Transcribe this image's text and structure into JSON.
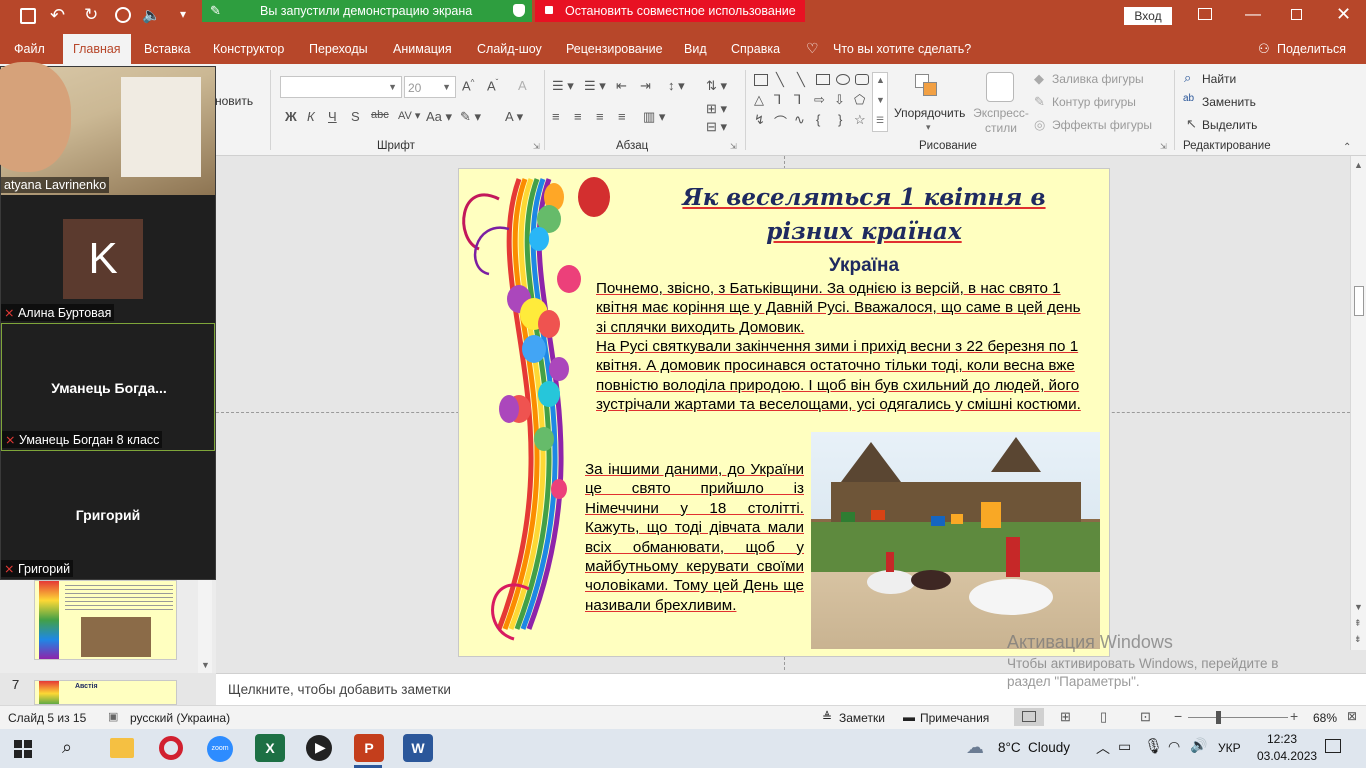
{
  "titlebar": {
    "share_banner": "Вы запустили демонстрацию экрана",
    "stop_share": "Остановить совместное использование",
    "signin": "Вход"
  },
  "ribbon_tabs": [
    "Файл",
    "Главная",
    "Вставка",
    "Конструктор",
    "Переходы",
    "Анимация",
    "Слайд-шоу",
    "Рецензирование",
    "Вид",
    "Справка"
  ],
  "tell_me": "Что вы хотите сделать?",
  "share_label": "Поделиться",
  "ribbon": {
    "clipboard_partial": "новить",
    "font_size": "20",
    "font_group": "Шрифт",
    "paragraph_group": "Абзац",
    "drawing_group": "Рисование",
    "editing_group": "Редактирование",
    "arrange": "Упорядочить",
    "quick_styles": "Экспресс-стили",
    "shape_fill": "Заливка фигуры",
    "shape_outline": "Контур фигуры",
    "shape_effects": "Эффекты фигуры",
    "find": "Найти",
    "replace": "Заменить",
    "select": "Выделить"
  },
  "participants": [
    {
      "name": "atyana Lavrinenko",
      "type": "video"
    },
    {
      "name": "Алина Буртовая",
      "type": "avatar",
      "initial": "K",
      "avatar_color": "#5b3a2e"
    },
    {
      "name": "Уманець Богдан 8 класс",
      "display": "Уманець  Богда...",
      "type": "text"
    },
    {
      "name": "Григорий",
      "display": "Григорий",
      "type": "text"
    }
  ],
  "thumbnail_7": {
    "number": "7",
    "title": "Австія"
  },
  "slide": {
    "title_line1": "Як веселяться 1 квітня в",
    "title_line2": "різних країнах",
    "subtitle": "Україна",
    "para1": "Почнемо, звісно, з Батьківщини. За однією із версій, в нас свято 1 квітня має коріння ще у Давній Русі. Вважалося, що саме в цей день зі сплячки виходить Домовик.",
    "para2": "На Русі святкували закінчення зими і прихід весни з 22 березня по 1 квітня. А домовик просинався остаточно тільки тоді, коли весна вже повністю володіла природою. І щоб він був схильний до людей, його зустрічали жартами та веселощами, усі одягались у смішні костюми.",
    "para3": "За іншими даними, до України це свято прийшло із Німеччини у 18 столітті. Кажуть, що тоді дівчата мали всіх обманювати, щоб у майбутньому керувати своїми чоловіками. Тому цей День ще називали брехливим."
  },
  "notes_placeholder": "Щелкните, чтобы добавить заметки",
  "watermark": {
    "line1": "Активация Windows",
    "line2": "Чтобы активировать Windows, перейдите в",
    "line3": "раздел \"Параметры\"."
  },
  "status": {
    "slide_of": "Слайд 5 из 15",
    "language": "русский (Украина)",
    "notes_btn": "Заметки",
    "comments_btn": "Примечания",
    "zoom": "68%"
  },
  "taskbar": {
    "weather_temp": "8°C",
    "weather_desc": "Cloudy",
    "lang": "УКР",
    "time": "12:23",
    "date": "03.04.2023"
  },
  "colors": {
    "accent": "#b7472a",
    "share_green": "#2e9e3f",
    "stop_red": "#e81123",
    "slide_bg": "#ffffc0",
    "title_color": "#1f2a60"
  }
}
